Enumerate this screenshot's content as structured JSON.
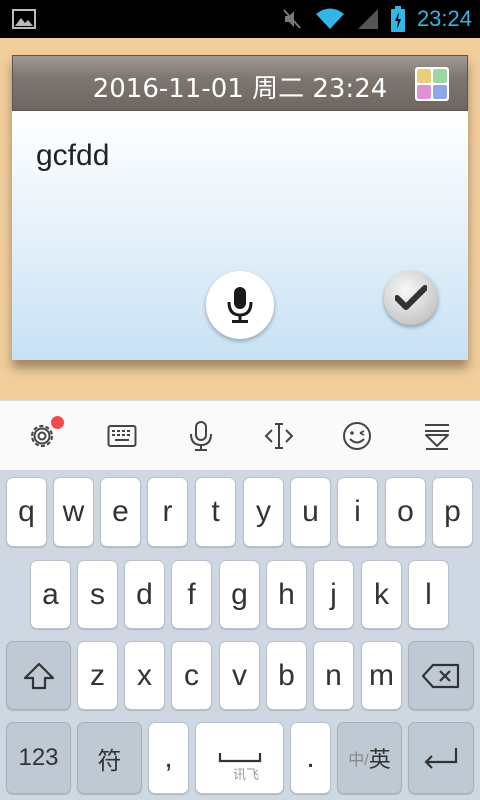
{
  "status_bar": {
    "time": "23:24"
  },
  "note": {
    "title": "2016-11-01 周二 23:24",
    "text": "gcfdd"
  },
  "colors": {
    "accent_time": "#33b5e5",
    "badge": "#f2494b",
    "palette": [
      "#e9cf7d",
      "#9fd7a4",
      "#de93d9",
      "#8ea7e6"
    ]
  },
  "toolbar": {
    "items": [
      "settings-icon",
      "keyboard-icon",
      "microphone-icon",
      "cursor-icon",
      "emoji-icon",
      "hide-keyboard-icon"
    ]
  },
  "keyboard": {
    "row1": [
      "q",
      "w",
      "e",
      "r",
      "t",
      "y",
      "u",
      "i",
      "o",
      "p"
    ],
    "row2": [
      "a",
      "s",
      "d",
      "f",
      "g",
      "h",
      "j",
      "k",
      "l"
    ],
    "row3": [
      "z",
      "x",
      "c",
      "v",
      "b",
      "n",
      "m"
    ],
    "num_label": "123",
    "symbol_label": "符",
    "comma_label": ",",
    "space_sub": "讯飞",
    "period_label": ".",
    "lang_small": "中/",
    "lang_big": "英"
  }
}
